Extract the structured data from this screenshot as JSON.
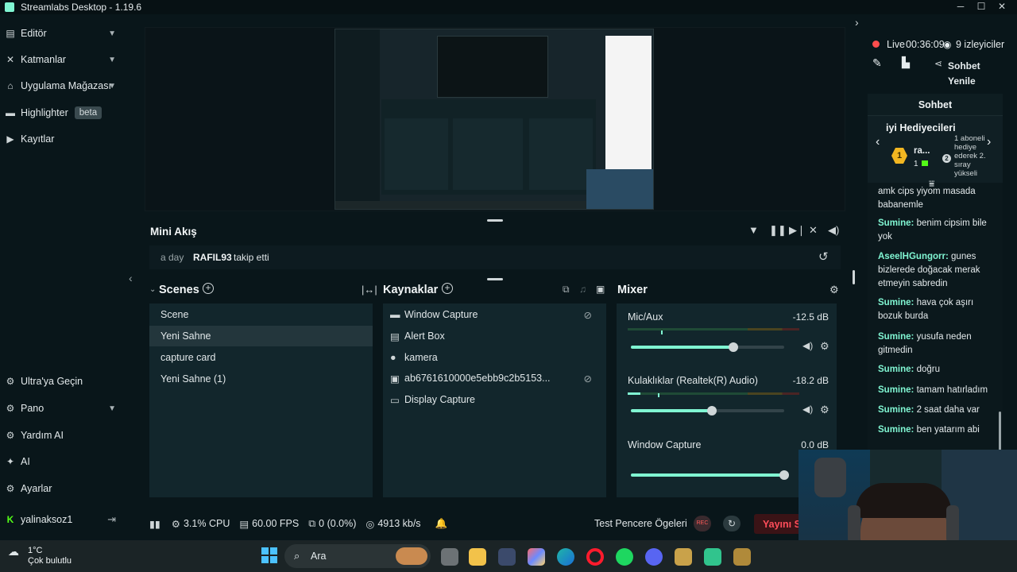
{
  "window": {
    "title": "Streamlabs Desktop - 1.19.6"
  },
  "nav": {
    "items": [
      {
        "label": "Editör"
      },
      {
        "label": "Katmanlar"
      },
      {
        "label": "Uygulama Mağazası"
      },
      {
        "label": "Highlighter",
        "badge": "beta"
      },
      {
        "label": "Kayıtlar"
      }
    ],
    "bottom": [
      {
        "label": "Ultra'ya Geçin"
      },
      {
        "label": "Pano"
      },
      {
        "label": "Yardım AI"
      },
      {
        "label": "AI"
      },
      {
        "label": "Ayarlar"
      },
      {
        "label": "yalinaksoz1"
      }
    ]
  },
  "miniflow": {
    "title": "Mini Akış",
    "event": {
      "time": "a day",
      "user": "RAFIL93",
      "action": "takip etti"
    }
  },
  "scenes": {
    "title": "Scenes",
    "items": [
      "Scene",
      "Yeni Sahne",
      "capture card",
      "Yeni Sahne (1)"
    ],
    "selected": "Yeni Sahne"
  },
  "sources": {
    "title": "Kaynaklar",
    "items": [
      {
        "label": "Window Capture",
        "icon": "window-icon"
      },
      {
        "label": "Alert Box",
        "icon": "alert-icon"
      },
      {
        "label": "kamera",
        "icon": "camera-icon"
      },
      {
        "label": "ab6761610000e5ebb9c2b5153...",
        "icon": "image-icon"
      },
      {
        "label": "Display Capture",
        "icon": "monitor-icon"
      }
    ]
  },
  "mixer": {
    "title": "Mixer",
    "channels": [
      {
        "label": "Mic/Aux",
        "db": "-12.5 dB",
        "level": 0.67
      },
      {
        "label": "Kulaklıklar (Realtek(R) Audio)",
        "db": "-18.2 dB",
        "level": 0.53
      },
      {
        "label": "Window Capture",
        "db": "0.0 dB",
        "level": 1.0
      }
    ]
  },
  "footer": {
    "cpu": "3.1% CPU",
    "fps": "60.00 FPS",
    "dropped": "0 (0.0%)",
    "bitrate": "4913 kb/s",
    "test_label": "Test Pencere Ögeleri",
    "rec_label": "REC",
    "go_live_label": "Yayını So"
  },
  "live": {
    "status": "Live",
    "timer": "00:36:09",
    "viewers": "9 izleyiciler",
    "refresh_chat": "Sohbet Yenile"
  },
  "chat": {
    "title": "Sohbet",
    "gifters_title": "iyi Hediyecileri",
    "gifter_name": "ra...",
    "gifter_count": "1",
    "gifter_text": "1 aboneli hediye ederek 2. sıray yükseli",
    "messages": [
      {
        "user": "",
        "text": "amk cips yiyom masada babanemle"
      },
      {
        "user": "Sumine:",
        "text": "benim cipsim bile yok"
      },
      {
        "user": "AseelHGungorr:",
        "text": "gunes bizlerede doğacak merak etmeyin sabredin"
      },
      {
        "user": "Sumine:",
        "text": "hava çok aşırı bozuk burda"
      },
      {
        "user": "Sumine:",
        "text": "yusufa neden gitmedin"
      },
      {
        "user": "Sumine:",
        "text": "doğru"
      },
      {
        "user": "Sumine:",
        "text": "tamam hatırladım"
      },
      {
        "user": "Sumine:",
        "text": "2 saat daha var"
      },
      {
        "user": "Sumine:",
        "text": "ben yatarım abi"
      }
    ]
  },
  "taskbar": {
    "weather_temp": "1°C",
    "weather_desc": "Çok bulutlu",
    "search_label": "Ara"
  },
  "colors": {
    "accent": "#80f5d2",
    "live": "#ff4d4d",
    "bg": "#09161a",
    "panel": "#12262c"
  }
}
